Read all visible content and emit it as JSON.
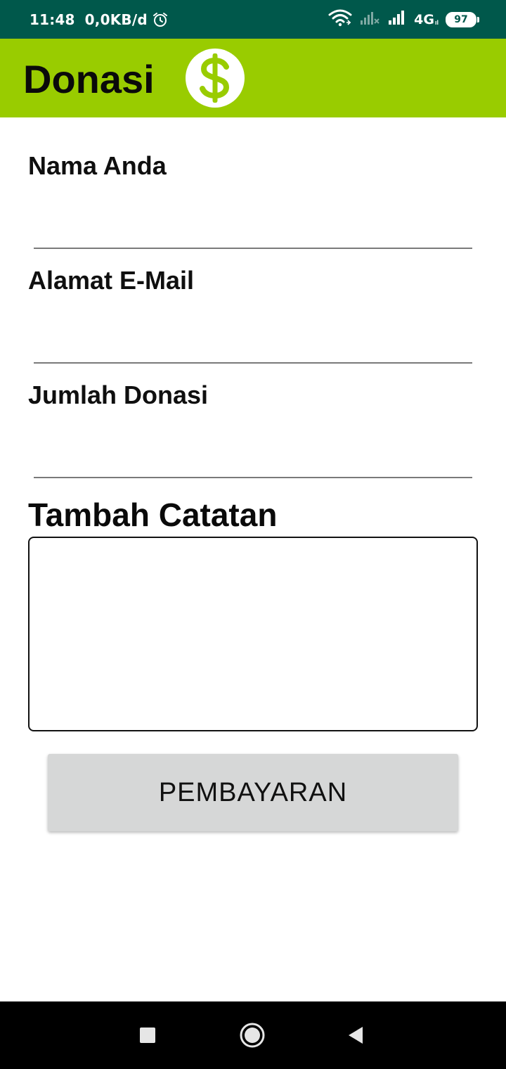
{
  "status_bar": {
    "time": "11:48",
    "data_speed": "0,0KB/d",
    "network_type": "4G",
    "network_sub": "ıl",
    "battery_level": "97",
    "icons": [
      "alarm-icon",
      "wifi-icon",
      "no-signal-icon",
      "signal-icon",
      "battery-icon"
    ]
  },
  "app_bar": {
    "title": "Donasi",
    "icon": "dollar-icon",
    "accent_color": "#99cc00"
  },
  "form": {
    "name_label": "Nama Anda",
    "name_value": "",
    "email_label": "Alamat E-Mail",
    "email_value": "",
    "amount_label": "Jumlah Donasi",
    "amount_value": "",
    "notes_heading": "Tambah Catatan",
    "notes_value": "",
    "submit_label": "PEMBAYARAN"
  },
  "nav_bar": {
    "icons": [
      "recent-apps-icon",
      "home-icon",
      "back-icon"
    ]
  },
  "colors": {
    "status_bar": "#00584b",
    "app_bar": "#99cc00",
    "button": "#d6d7d7"
  }
}
